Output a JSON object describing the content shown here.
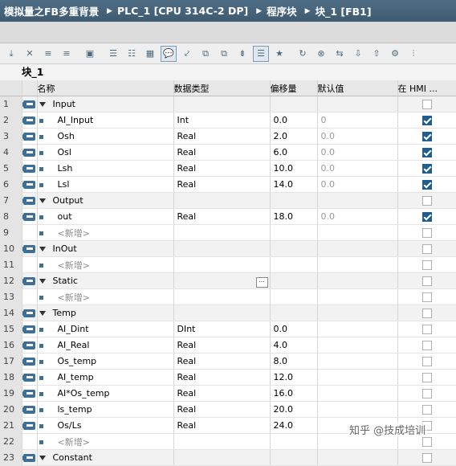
{
  "breadcrumb": [
    "模拟量之FB多重背景",
    "PLC_1 [CPU 314C-2 DP]",
    "程序块",
    "块_1 [FB1]"
  ],
  "block_title": "块_1",
  "columns": {
    "name": "名称",
    "datatype": "数据类型",
    "offset": "偏移量",
    "default": "默认值",
    "hmi": "在 HMI ..."
  },
  "rows": [
    {
      "num": "1",
      "kind": "section",
      "name": "Input",
      "type": "",
      "offset": "",
      "default": "",
      "hmi": false
    },
    {
      "num": "2",
      "kind": "var",
      "name": "AI_Input",
      "type": "Int",
      "offset": "0.0",
      "default": "0",
      "hmi": true
    },
    {
      "num": "3",
      "kind": "var",
      "name": "Osh",
      "type": "Real",
      "offset": "2.0",
      "default": "0.0",
      "hmi": true
    },
    {
      "num": "4",
      "kind": "var",
      "name": "Osl",
      "type": "Real",
      "offset": "6.0",
      "default": "0.0",
      "hmi": true
    },
    {
      "num": "5",
      "kind": "var",
      "name": "Lsh",
      "type": "Real",
      "offset": "10.0",
      "default": "0.0",
      "hmi": true
    },
    {
      "num": "6",
      "kind": "var",
      "name": "Lsl",
      "type": "Real",
      "offset": "14.0",
      "default": "0.0",
      "hmi": true
    },
    {
      "num": "7",
      "kind": "section",
      "name": "Output",
      "type": "",
      "offset": "",
      "default": "",
      "hmi": false
    },
    {
      "num": "8",
      "kind": "var",
      "name": "out",
      "type": "Real",
      "offset": "18.0",
      "default": "0.0",
      "hmi": true
    },
    {
      "num": "9",
      "kind": "add",
      "name": "<新增>",
      "type": "",
      "offset": "",
      "default": "",
      "hmi": false
    },
    {
      "num": "10",
      "kind": "section",
      "name": "InOut",
      "type": "",
      "offset": "",
      "default": "",
      "hmi": false
    },
    {
      "num": "11",
      "kind": "add",
      "name": "<新增>",
      "type": "",
      "offset": "",
      "default": "",
      "hmi": false
    },
    {
      "num": "12",
      "kind": "section",
      "name": "Static",
      "type": "",
      "offset": "",
      "default": "",
      "hmi": false
    },
    {
      "num": "13",
      "kind": "add",
      "name": "<新增>",
      "type": "",
      "offset": "",
      "default": "",
      "hmi": false
    },
    {
      "num": "14",
      "kind": "section",
      "name": "Temp",
      "type": "",
      "offset": "",
      "default": "",
      "hmi": false
    },
    {
      "num": "15",
      "kind": "var",
      "name": "AI_Dint",
      "type": "DInt",
      "offset": "0.0",
      "default": "",
      "hmi": false
    },
    {
      "num": "16",
      "kind": "var",
      "name": "AI_Real",
      "type": "Real",
      "offset": "4.0",
      "default": "",
      "hmi": false
    },
    {
      "num": "17",
      "kind": "var",
      "name": "Os_temp",
      "type": "Real",
      "offset": "8.0",
      "default": "",
      "hmi": false
    },
    {
      "num": "18",
      "kind": "var",
      "name": "AI_temp",
      "type": "Real",
      "offset": "12.0",
      "default": "",
      "hmi": false
    },
    {
      "num": "19",
      "kind": "var",
      "name": "AI*Os_temp",
      "type": "Real",
      "offset": "16.0",
      "default": "",
      "hmi": false
    },
    {
      "num": "20",
      "kind": "var",
      "name": "ls_temp",
      "type": "Real",
      "offset": "20.0",
      "default": "",
      "hmi": false
    },
    {
      "num": "21",
      "kind": "var",
      "name": "Os/Ls",
      "type": "Real",
      "offset": "24.0",
      "default": "",
      "hmi": false
    },
    {
      "num": "22",
      "kind": "add",
      "name": "<新增>",
      "type": "",
      "offset": "",
      "default": "",
      "hmi": false
    },
    {
      "num": "23",
      "kind": "section",
      "name": "Constant",
      "type": "",
      "offset": "",
      "default": "",
      "hmi": false
    }
  ],
  "watermark": "知乎 @技成培训",
  "colors": {
    "title_bg": "#445f75",
    "checkbox_on": "#1f5d8e",
    "interface_icon": "#3d6f99"
  }
}
